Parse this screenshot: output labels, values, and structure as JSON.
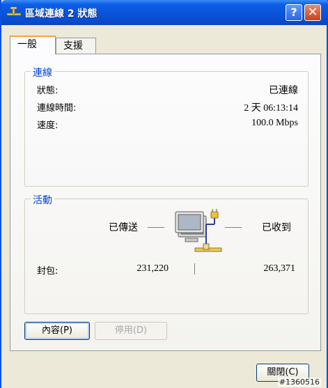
{
  "window": {
    "title": "區域連線 2 狀態",
    "help_glyph": "?",
    "close_glyph": "✕"
  },
  "tabs": [
    {
      "label": "一般",
      "active": true
    },
    {
      "label": "支援",
      "active": false
    }
  ],
  "connection": {
    "legend": "連線",
    "rows": [
      {
        "label": "狀態:",
        "value": "已連線"
      },
      {
        "label": "連線時間:",
        "value": "2 天 06:13:14"
      },
      {
        "label": "速度:",
        "value": "100.0 Mbps"
      }
    ]
  },
  "activity": {
    "legend": "活動",
    "sent_label": "已傳送",
    "received_label": "已收到",
    "packets_label": "封包:",
    "sent_value": "231,220",
    "received_value": "263,371",
    "icon": "network-computer-icon"
  },
  "buttons": {
    "properties": "內容(P)",
    "disable": "停用(D)",
    "close": "關閉(C)"
  },
  "watermark": "#1360516",
  "colors": {
    "titlebar": "#0a53d8",
    "legend_text": "#0046d5",
    "face": "#ece9d8",
    "tab_highlight": "#f5a33d"
  }
}
